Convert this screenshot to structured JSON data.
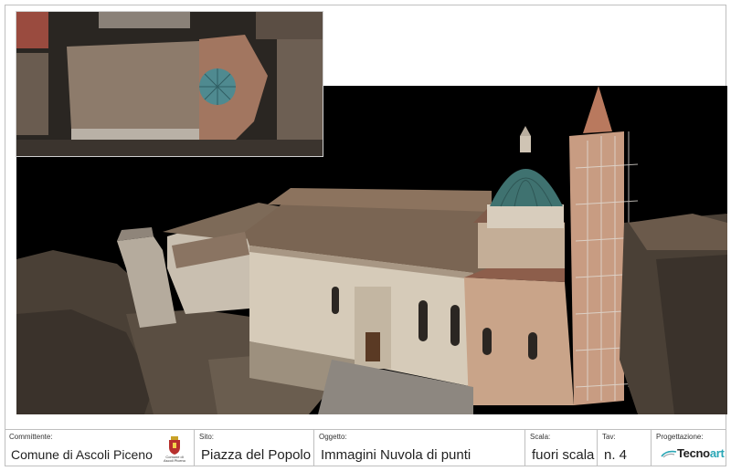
{
  "colors": {
    "frame": "#bfbfbf",
    "render_background": "#000000",
    "logo_accent": "#2aa7b6",
    "dome": "#3f7270"
  },
  "title_block": {
    "committente": {
      "label": "Committente:",
      "value": "Comune di Ascoli Piceno"
    },
    "crest": {
      "icon": "coat-of-arms-icon",
      "caption": "Comune di Ascoli Piceno"
    },
    "sito": {
      "label": "Sito:",
      "value": "Piazza del Popolo"
    },
    "oggetto": {
      "label": "Oggetto:",
      "value": "Immagini Nuvola di punti"
    },
    "scala": {
      "label": "Scala:",
      "value": "fuori scala"
    },
    "tav": {
      "label": "Tav:",
      "value": "n. 4"
    },
    "progettazione": {
      "label": "Progettazione:",
      "logo_prefix": "Tecno",
      "logo_suffix": "art",
      "icon": "tecnoart-logo-icon"
    }
  }
}
